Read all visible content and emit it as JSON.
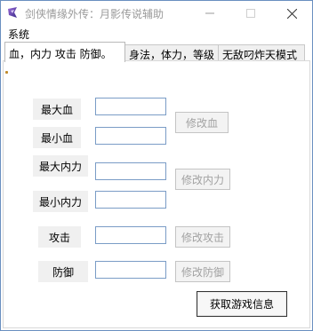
{
  "window": {
    "title": "剑侠情缘外传：月影传说辅助"
  },
  "menubar": {
    "items": [
      "系统"
    ]
  },
  "tabs": [
    {
      "label": "血，内力 攻击 防御。",
      "active": true
    },
    {
      "label": "身法，体力，等级",
      "active": false
    },
    {
      "label": "无敌叼炸天模式",
      "active": false
    }
  ],
  "form": {
    "max_hp_label": "最大血",
    "min_hp_label": "最小血",
    "max_mp_label": "最大内力",
    "min_mp_label": "最小内力",
    "attack_label": "攻击",
    "defense_label": "防御",
    "max_hp_value": "",
    "min_hp_value": "",
    "max_mp_value": "",
    "min_mp_value": "",
    "attack_value": "",
    "defense_value": ""
  },
  "buttons": {
    "modify_hp": "修改血",
    "modify_mp": "修改内力",
    "modify_attack": "修改攻击",
    "modify_defense": "修改防御",
    "get_info": "获取游戏信息"
  },
  "colors": {
    "window_border": "#6a8fc0",
    "field_border": "#7a9cc6",
    "disabled_text": "#a2a2a2"
  }
}
